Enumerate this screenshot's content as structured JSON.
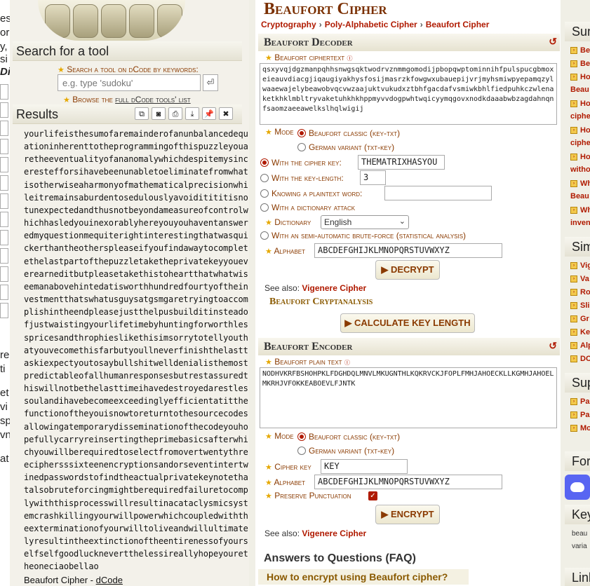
{
  "left_strip": [
    "es",
    "or",
    "y,",
    "si",
    "Di",
    "re",
    "ti",
    "et",
    "vi",
    "sp",
    "vn",
    "at"
  ],
  "sidebar": {
    "search_title": "Search for a tool",
    "search_label": "Search a tool on dCode by keywords:",
    "search_placeholder": "e.g. type 'sudoku'",
    "search_button_icon": "enter-icon",
    "browse_prefix": "Browse the",
    "browse_link": "full dCode tools' list",
    "results_title": "Results",
    "result_tools": [
      "copy-icon",
      "screenshot-icon",
      "print-icon",
      "download-icon",
      "pin-icon",
      "close-icon"
    ],
    "result_text": "yourlifeisthesumofaremainderofanunbalancedequationinherenttotheprogrammingofthispuzzleyouaretheeventualityofananomalywhichdespitemysincerestefforsihavebeenunabletoeliminatefromwhatisotherwiseaharmonyofmathematicalprecisionwhileitremainsaburdentosedulouslyavoiditititisnotunexpectedandthusnotbeyondameasureofcontrolwhichhasledyouinexorablyhereyouyouhaventansweredmyquestionmequiterightinterestingthatwasquickerthantheotherspleaseifyoufindawaytocompletethelastpartofthepuzzletaketheprivatekeyyoueverearneditbutpleasetakethistoheartthatwhatwiseemanabovehintedatisworthhundredfourtyoftheinvestmentthatswhatusguysatgsmgaretryingtoaccomplishintheendpleasejustthelpusbuilditinsteadofjustwaistingyourlifetimebyhuntingforworthlesspricesandthrophieslikethisimsorrytotellyouthatyouvecomethisfarbutyoullneverfinishthelasttaskiexpectyoutosaybullshitwelldenialisthemostpredictableofallhumanresponsesbutrestassuredthiswillnotbethelasttimeihavedestroyedarestlessoulandihavebecomeexceedinglyefficientatitthefunctionoftheyouisnowtoreturntothesourcecodesallowingatemporarydisseminationofthecodeyouhopefullycarryreinsertingtheprimebasicsafterwhichyouwillberequiredtoselectfromovertwentythreeciphersssixteenencryptionsandorseventintertwinedpasswordstofindtheactualprivatekeynotethatalsobruteforcingmightberequiredfailuretocomplywiththisprocesswillresultinacataclysmicsystemcrashkillingyourwillpowerwhichcoupledwiththeexterminationofyourwilltoliveandwillultimatelyresultintheextinctionoftheentirenessofyourselfselfgoodlucknevertthelessireallyhopeyouretheoneciaobellao",
    "footer_prefix": "Beaufort Cipher - ",
    "footer_link": "dCode"
  },
  "main": {
    "title": "Beaufort Cipher",
    "breadcrumb": [
      "Cryptography",
      "Poly-Alphabetic Cipher",
      "Beaufort Cipher"
    ],
    "decoder": {
      "heading": "Beaufort Decoder",
      "ciphertext_label": "Beaufort ciphertext",
      "ciphertext": "qsxyvqjdgzmanpqhhsnwgsqktwodrvznmmgomodijpbopqwptominnihfpulspucgbmoxeieauvdiacgjiqaugiyakhysfosijmasrzkfowgwxubauepijvrjmyhsmiwpyepamqzylwaaewajelybeawobvqcvwzaajuktvukudxztbhfgacdafvsmiwkbhlfiedpuhkczwlenaketkhklmbltryvaketuhkhkhppmyvvdogpwhtwqicyymqgovxnodkdaaabwbzagdahnqnfsaomzaeeawelkslhqlwigij",
      "mode_label": "Mode",
      "mode_options": [
        "Beaufort classic (key-txt)",
        "German variant (txt-key)"
      ],
      "option_key": "With the cipher key:",
      "key_value": "THEMATRIXHASYOU",
      "option_length": "With the key-length:",
      "length_value": "3",
      "option_plain": "Knowing a plaintext word:",
      "option_dict": "With a dictionary attack",
      "dict_label": "Dictionary",
      "dict_value": "English",
      "option_brute": "With an semi-automatic brute-force (statistical analysis)",
      "alphabet_label": "Alphabet",
      "alphabet": "ABCDEFGHIJKLMNOPQRSTUVWXYZ",
      "decrypt_button": "▶ DECRYPT",
      "see_also_prefix": "See also:",
      "see_also_link": "Vigenere Cipher"
    },
    "cryptanalysis": {
      "heading": "Beaufort Cryptanalysis",
      "button": "▶ CALCULATE KEY LENGTH"
    },
    "encoder": {
      "heading": "Beaufort Encoder",
      "plaintext_label": "Beaufort plain text",
      "plaintext": "NODHVKRFBSHOHPKLFDGHDQLMNVLMKUGNTHLKQKRVCKJFOPLFMHJAHOECKLLKGMHJAHOELMKRHJVFOKKEABOEVLFJNTK",
      "mode_label": "Mode",
      "mode_options": [
        "Beaufort classic (key-txt)",
        "German variant (txt-key)"
      ],
      "key_label": "Cipher key",
      "key_value": "KEY",
      "alphabet_label": "Alphabet",
      "alphabet": "ABCDEFGHIJKLMNOPQRSTUVWXYZ",
      "punct_label": "Preserve Punctuation",
      "encrypt_button": "▶ ENCRYPT",
      "see_also_prefix": "See also:",
      "see_also_link": "Vigenere Cipher"
    },
    "faq_title": "Answers to Questions (FAQ)",
    "faq_first": "How to encrypt using Beaufort cipher?"
  },
  "right": {
    "summary_title": "Sum",
    "summary_items": [
      "Be",
      "Be",
      "Ho",
      "Beau",
      "Ho",
      "ciphe",
      "Ho",
      "ciphe",
      "Ho",
      "witho",
      "Wh",
      "Beau",
      "Wh",
      "inven"
    ],
    "similar_title": "Sim",
    "similar_items": [
      "Vig",
      "Va",
      "Ro",
      "Sli",
      "Gr",
      "Ke",
      "Alp",
      "DC"
    ],
    "support_title": "Sup",
    "support_items": [
      "Pa",
      "Pa",
      "Mo"
    ],
    "forum_title": "For",
    "keywords_title": "Key",
    "keywords_text": [
      "beau",
      "varia"
    ],
    "links_title": "Link",
    "colors": {
      "accent": "#b01a00",
      "brand": "#8a3a00",
      "bg": "#f0efe6"
    }
  }
}
